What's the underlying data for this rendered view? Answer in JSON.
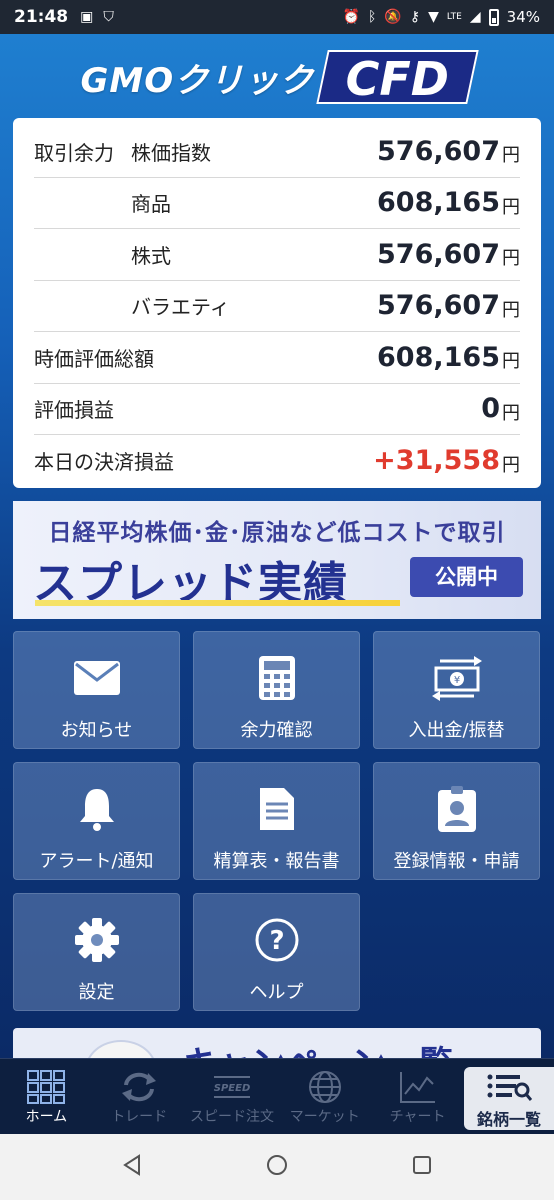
{
  "status_bar": {
    "time": "21:48",
    "battery": "34%",
    "lte": "LTE"
  },
  "logo": {
    "brand": "GMOクリック",
    "product": "CFD"
  },
  "balance": {
    "group_label": "取引余力",
    "yen": "円",
    "rows": [
      {
        "label": "株価指数",
        "value": "576,607"
      },
      {
        "label": "商品",
        "value": "608,165"
      },
      {
        "label": "株式",
        "value": "576,607"
      },
      {
        "label": "バラエティ",
        "value": "576,607"
      },
      {
        "label": "時価評価総額",
        "value": "608,165"
      },
      {
        "label": "評価損益",
        "value": "0"
      },
      {
        "label": "本日の決済損益",
        "value": "+31,558"
      }
    ]
  },
  "banner": {
    "top_text": "日経平均株価･金･原油など低コストで取引",
    "main_text": "スプレッド実績",
    "badge": "公開中"
  },
  "menu": [
    {
      "label": "お知らせ",
      "icon": "mail-icon"
    },
    {
      "label": "余力確認",
      "icon": "calculator-icon"
    },
    {
      "label": "入出金/振替",
      "icon": "money-transfer-icon"
    },
    {
      "label": "アラート/通知",
      "icon": "bell-icon"
    },
    {
      "label": "精算表・報告書",
      "icon": "document-icon"
    },
    {
      "label": "登録情報・申請",
      "icon": "id-badge-icon"
    },
    {
      "label": "設定",
      "icon": "gear-icon"
    },
    {
      "label": "ヘルプ",
      "icon": "help-icon"
    }
  ],
  "campaign": {
    "text": "キャンペーン一覧"
  },
  "bottom_nav": [
    {
      "label": "ホーム",
      "icon": "home-grid-icon",
      "active": true
    },
    {
      "label": "トレード",
      "icon": "trade-arrows-icon"
    },
    {
      "label": "スピード注文",
      "icon": "speed-icon",
      "icon_text": "SPEED"
    },
    {
      "label": "マーケット",
      "icon": "globe-icon"
    },
    {
      "label": "チャート",
      "icon": "chart-icon"
    },
    {
      "label": "銘柄一覧",
      "icon": "list-search-icon"
    }
  ],
  "colors": {
    "accent_red": "#e03b2e",
    "brand_navy": "#1b2a86"
  }
}
